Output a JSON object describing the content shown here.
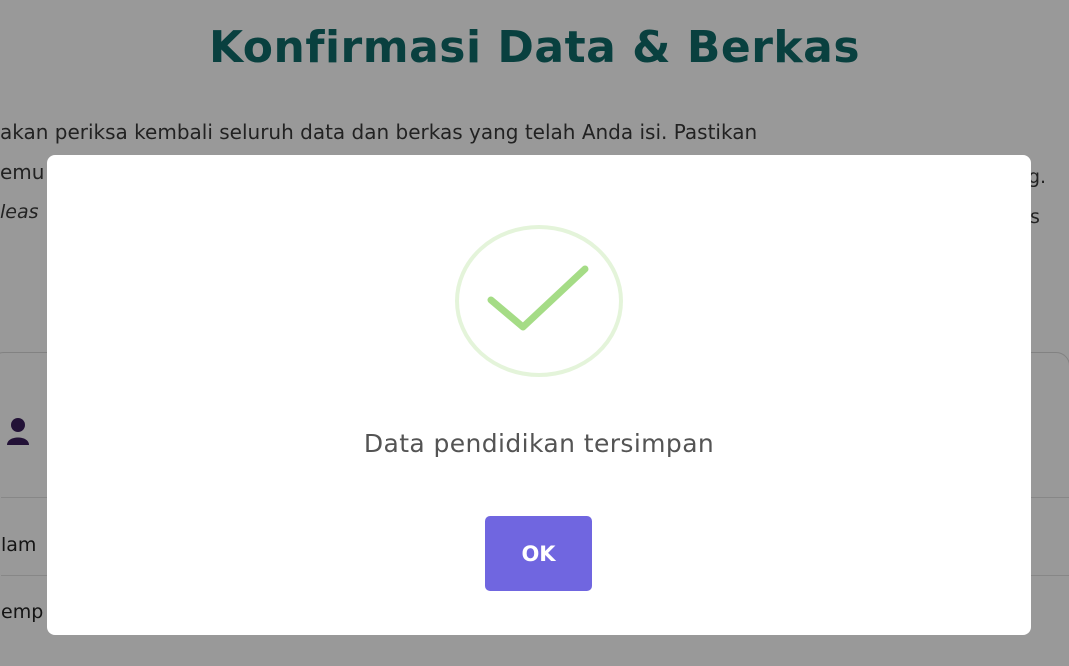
{
  "page": {
    "title": "Konfirmasi Data & Berkas",
    "intro_line1": "akan periksa kembali seluruh data dan berkas yang telah Anda isi. Pastikan",
    "intro_line2_left": "emu",
    "intro_line2_right": "g.",
    "intro_line3_left": "leas",
    "intro_line3_right": "s"
  },
  "card": {
    "user_icon": "user-icon",
    "row1_label": "lam",
    "row2_label": "emp"
  },
  "modal": {
    "icon": "check-circle-icon",
    "message": "Data pendidikan tersimpan",
    "ok_label": "OK",
    "accent_color": "#7066e0",
    "success_color": "#a5dc86"
  }
}
